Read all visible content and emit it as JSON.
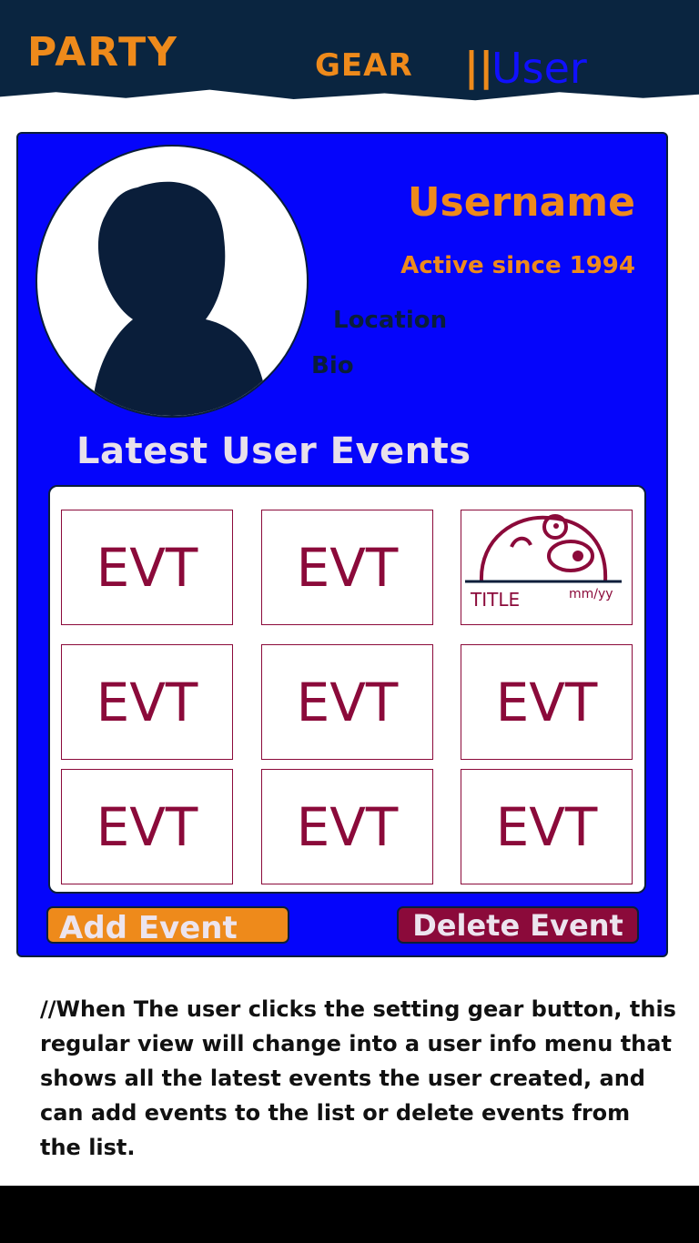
{
  "header": {
    "brand": "PARTY",
    "nav_gear": "GEAR",
    "nav_separator": "||",
    "nav_user": "User"
  },
  "profile": {
    "username": "Username",
    "active_since": "Active since 1994",
    "location": "Location",
    "bio": "Bio"
  },
  "events": {
    "section_title": "Latest User Events",
    "tiles": [
      {
        "label": "EVT"
      },
      {
        "label": "EVT"
      },
      {
        "label": "",
        "title": "TITLE",
        "date": "mm/yy"
      },
      {
        "label": "EVT"
      },
      {
        "label": "EVT"
      },
      {
        "label": "EVT"
      },
      {
        "label": "EVT"
      },
      {
        "label": "EVT"
      },
      {
        "label": "EVT"
      }
    ]
  },
  "actions": {
    "add_label": "Add Event",
    "delete_label": "Delete Event"
  },
  "note": "//When The user clicks the setting gear button, this regular  view will  change into a user info menu that shows all the latest events the user created, and can add events to the list or delete events from the list.",
  "colors": {
    "topbar": "#0a2540",
    "card": "#0505fb",
    "accent_orange": "#ee8a1b",
    "accent_maroon": "#8b0a3a",
    "user_blue": "#1010ff"
  }
}
